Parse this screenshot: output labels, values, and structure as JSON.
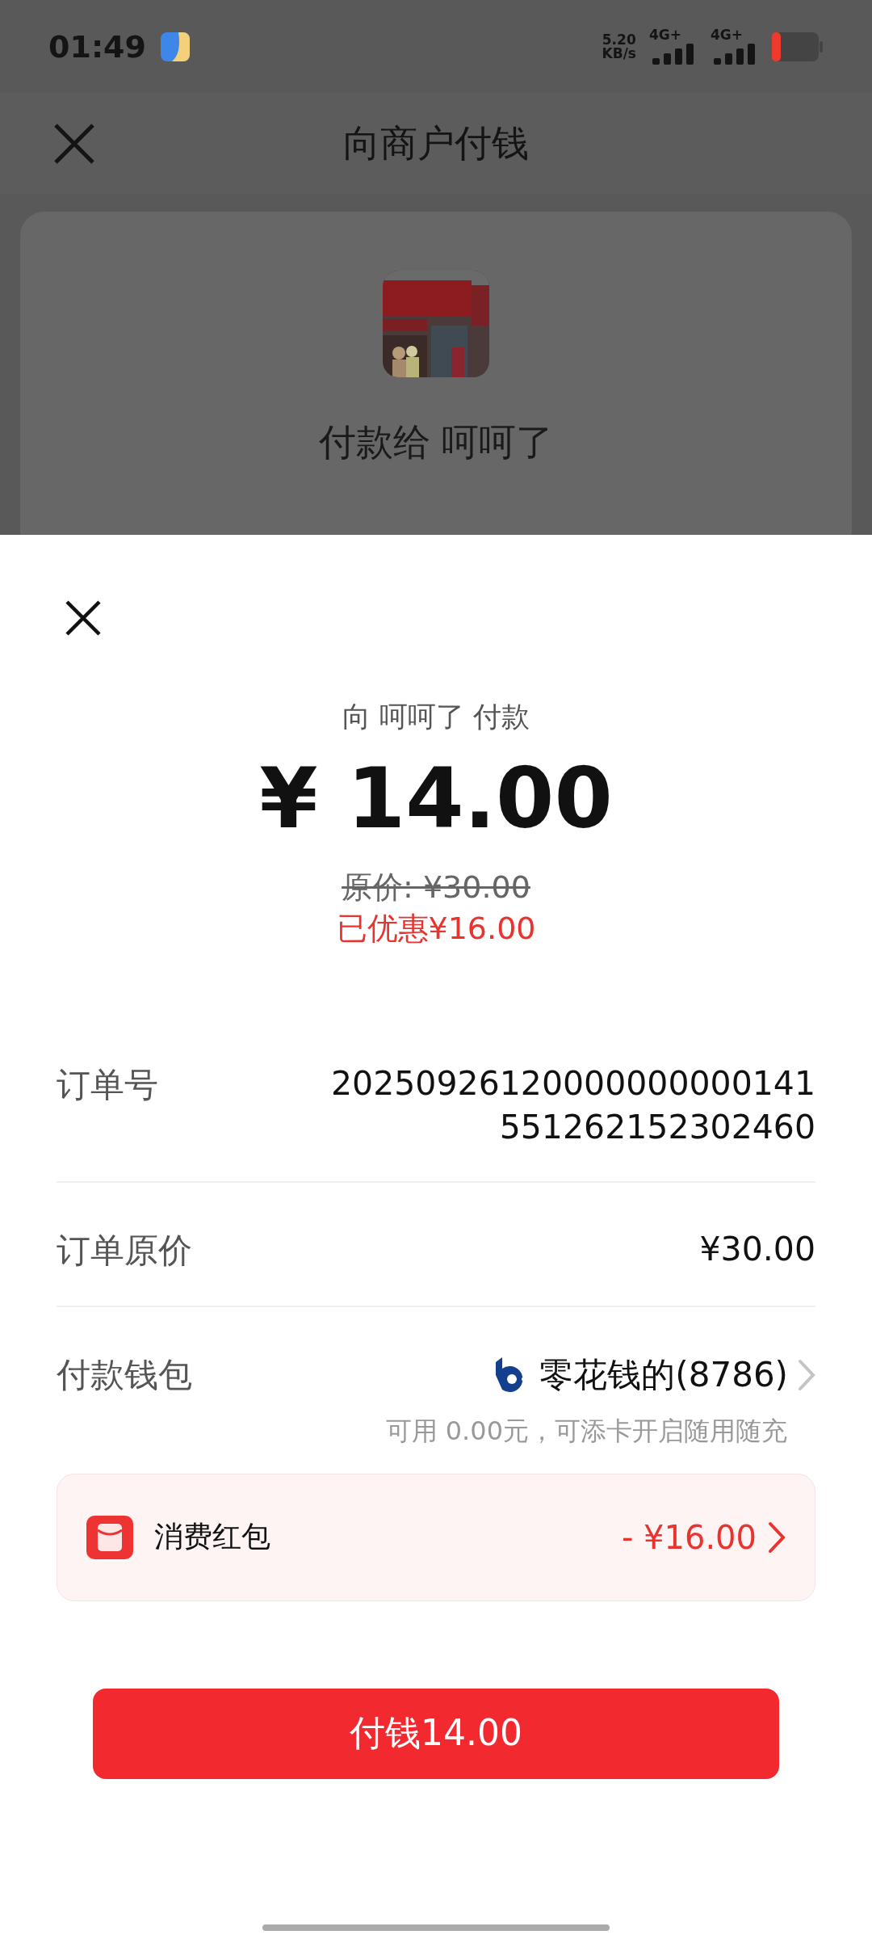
{
  "status_bar": {
    "time": "01:49",
    "net_speed": "5.20",
    "net_unit": "KB/s",
    "sim_1": "4G+",
    "sim_2": "4G+"
  },
  "header": {
    "title": "向商户付钱"
  },
  "merchant_card": {
    "payee": "付款给 呵呵了"
  },
  "sheet": {
    "subtitle": "向 呵呵了 付款",
    "amount": "¥ 14.00",
    "original_price": "原价: ¥30.00",
    "discount": "已优惠¥16.00",
    "rows": [
      {
        "label": "订单号",
        "value": "20250926120000000000141 551262152302460"
      },
      {
        "label": "订单原价",
        "value": "¥30.00"
      },
      {
        "label": "付款钱包",
        "value": "零花钱的(8786)",
        "note": "可用 0.00元，可添卡开启随用随充"
      }
    ],
    "coupon": {
      "label": "消费红包",
      "value": "- ¥16.00"
    },
    "pay_button": "付钱14.00"
  }
}
